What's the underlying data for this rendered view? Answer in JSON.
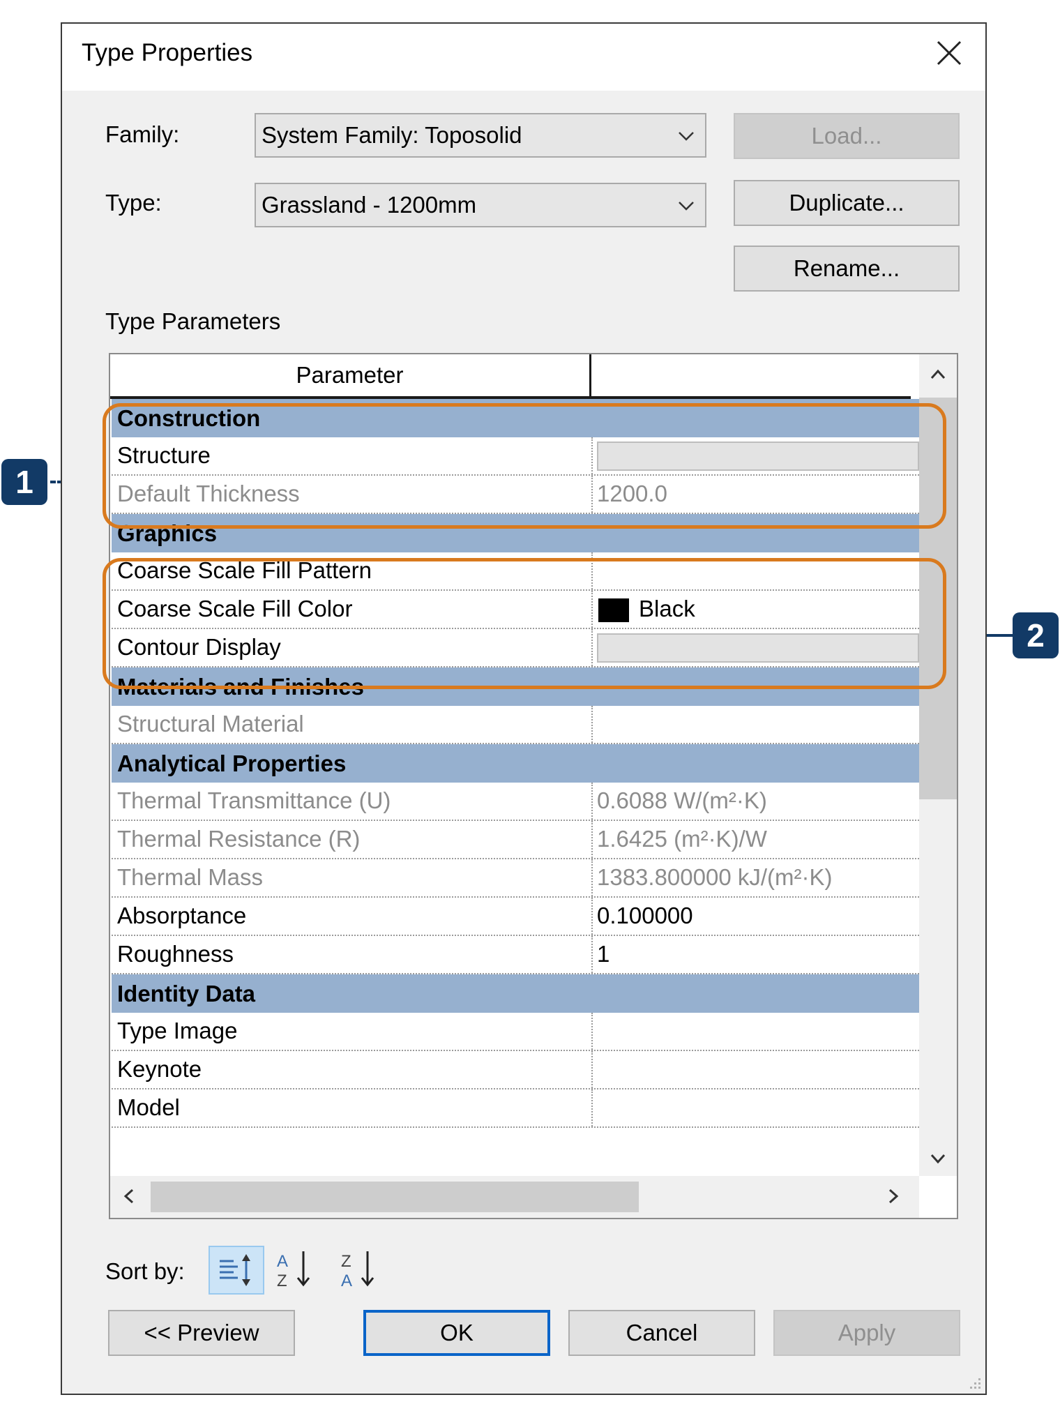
{
  "window": {
    "title": "Type Properties"
  },
  "family": {
    "label": "Family:",
    "value": "System Family: Toposolid"
  },
  "type": {
    "label": "Type:",
    "value": "Grassland - 1200mm"
  },
  "buttons": {
    "load": "Load...",
    "duplicate": "Duplicate...",
    "rename": "Rename..."
  },
  "type_parameters": {
    "label": "Type Parameters",
    "header": {
      "parameter": "Parameter",
      "value": ""
    },
    "groups": [
      {
        "name": "Construction",
        "rows": [
          {
            "name": "Structure",
            "value": "",
            "style": "box"
          },
          {
            "name": "Default Thickness",
            "value": "1200.0",
            "dim": true
          }
        ]
      },
      {
        "name": "Graphics",
        "rows": [
          {
            "name": "Coarse Scale Fill Pattern",
            "value": ""
          },
          {
            "name": "Coarse Scale Fill Color",
            "value": "Black",
            "style": "swatch",
            "swatch_color": "#000000"
          },
          {
            "name": "Contour Display",
            "value": "",
            "style": "box"
          }
        ]
      },
      {
        "name": "Materials and Finishes",
        "rows": [
          {
            "name": "Structural Material",
            "value": "",
            "dim": true
          }
        ]
      },
      {
        "name": "Analytical Properties",
        "rows": [
          {
            "name": "Thermal Transmittance (U)",
            "value": "0.6088 W/(m²·K)",
            "dim": true
          },
          {
            "name": "Thermal Resistance (R)",
            "value": "1.6425 (m²·K)/W",
            "dim": true
          },
          {
            "name": "Thermal Mass",
            "value": "1383.800000 kJ/(m²·K)",
            "dim": true
          },
          {
            "name": "Absorptance",
            "value": "0.100000"
          },
          {
            "name": "Roughness",
            "value": "1"
          }
        ]
      },
      {
        "name": "Identity Data",
        "rows": [
          {
            "name": "Type Image",
            "value": ""
          },
          {
            "name": "Keynote",
            "value": ""
          },
          {
            "name": "Model",
            "value": ""
          }
        ]
      }
    ]
  },
  "sort": {
    "label": "Sort by:"
  },
  "footer": {
    "preview": "<< Preview",
    "ok": "OK",
    "cancel": "Cancel",
    "apply": "Apply"
  },
  "callouts": [
    {
      "number": "1"
    },
    {
      "number": "2"
    }
  ],
  "colors": {
    "group_header": "#96b0cf",
    "callout_border": "#d97a1e",
    "badge": "#123a66",
    "default_button_border": "#0a64c8"
  }
}
